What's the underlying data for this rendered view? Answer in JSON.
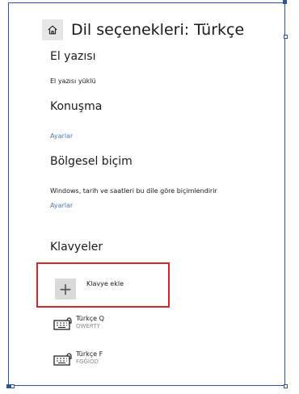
{
  "header": {
    "title": "Dil seçenekleri: Türkçe",
    "home_icon": "home-icon"
  },
  "handwriting": {
    "title": "El yazısı",
    "status": "El yazısı yüklü"
  },
  "speech": {
    "title": "Konuşma",
    "settings_link": "Ayarlar"
  },
  "regional": {
    "title": "Bölgesel biçim",
    "description": "Windows, tarih ve saatleri bu dile göre biçimlendirir",
    "settings_link": "Ayarlar"
  },
  "keyboards": {
    "title": "Klavyeler",
    "add_label": "Klavye ekle",
    "add_icon": "plus-icon",
    "items": [
      {
        "name": "Türkçe Q",
        "layout": "QWERTY",
        "icon": "keyboard-icon"
      },
      {
        "name": "Türkçe F",
        "layout": "FGĞIOD",
        "icon": "keyboard-icon"
      }
    ]
  },
  "colors": {
    "frame": "#2f5597",
    "highlight": "#d0272d",
    "link": "#4a7ab3"
  }
}
